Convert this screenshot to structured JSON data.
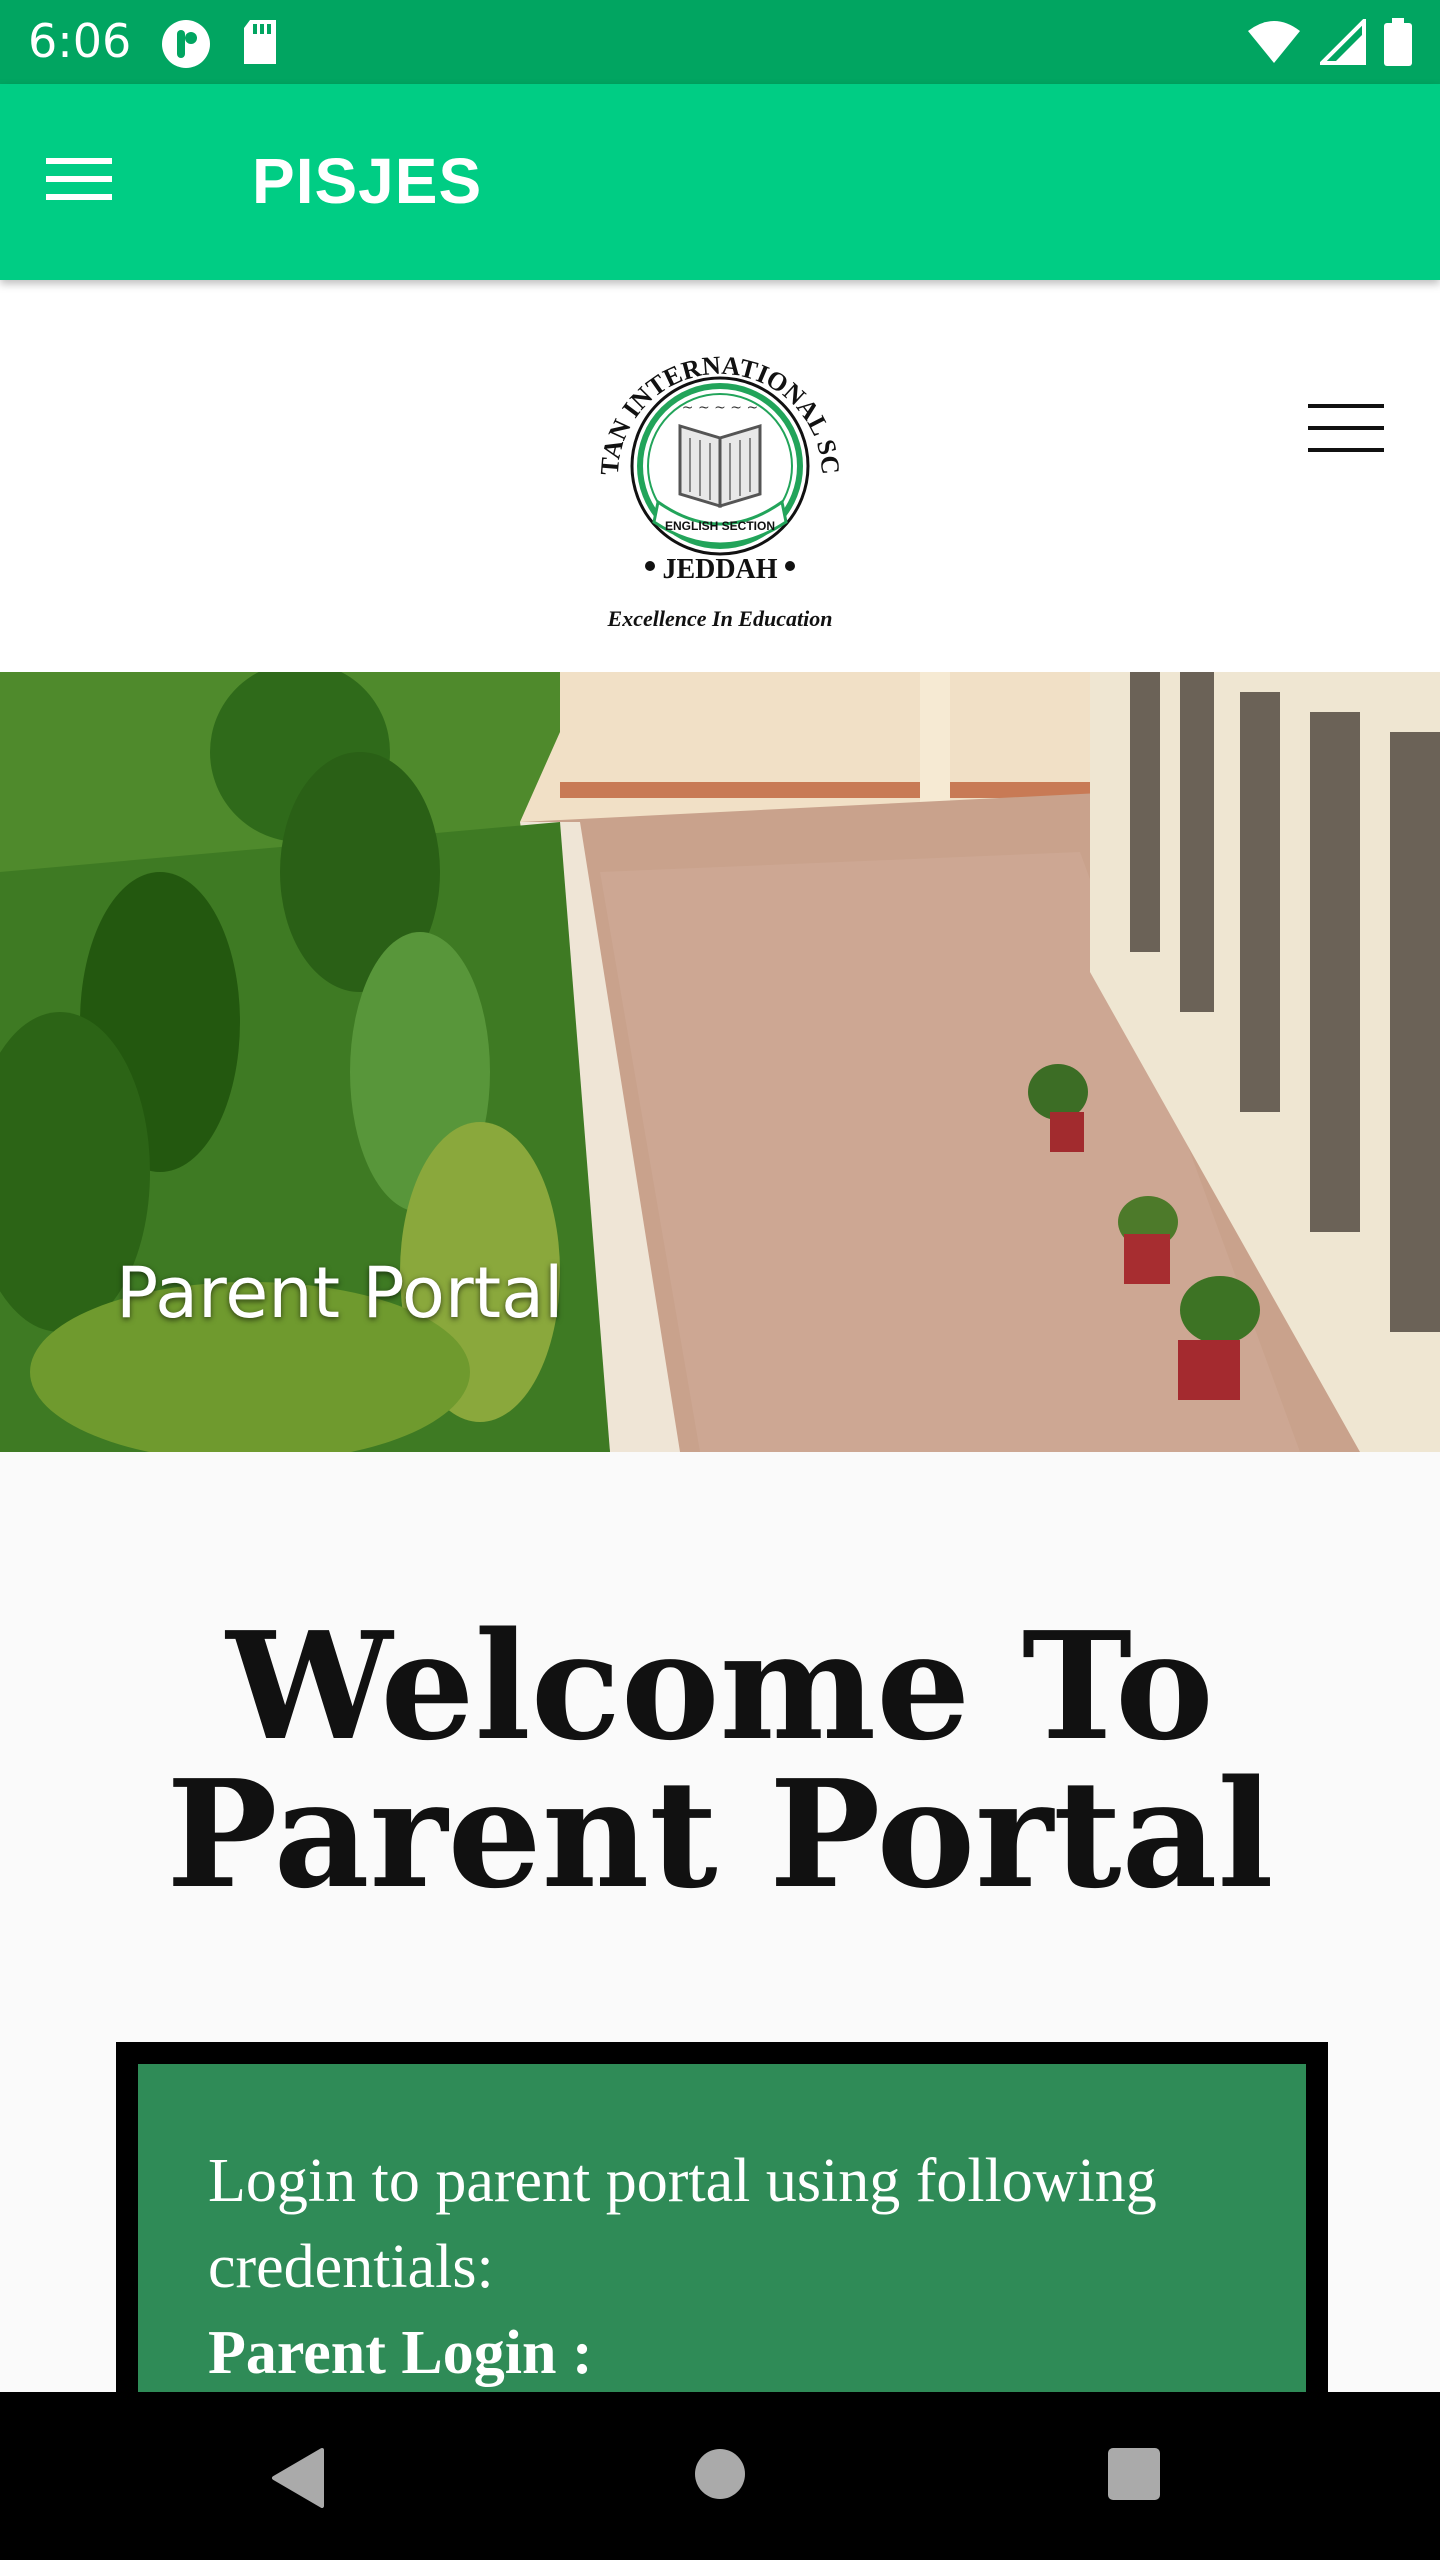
{
  "status_bar": {
    "time": "6:06",
    "icons": [
      "data-icon",
      "sd-card-icon",
      "wifi-icon",
      "signal-icon",
      "battery-icon"
    ]
  },
  "app_bar": {
    "title": "PISJES",
    "color": "#00cd84"
  },
  "logo": {
    "ring_text": "PAKISTAN INTERNATIONAL SCHOOL",
    "ribbon_text": "ENGLISH SECTION",
    "city": "JEDDAH",
    "tagline": "Excellence In Education"
  },
  "hero": {
    "caption": "Parent Portal"
  },
  "welcome": {
    "line1": "Welcome To",
    "line2": "Parent Portal"
  },
  "credentials": {
    "intro": "Login to parent portal using following credentials:",
    "login_label": "Parent Login :",
    "box_color": "#2f8b57"
  },
  "nav_bar": {
    "icons": [
      "back-icon",
      "home-icon",
      "recents-icon"
    ]
  }
}
